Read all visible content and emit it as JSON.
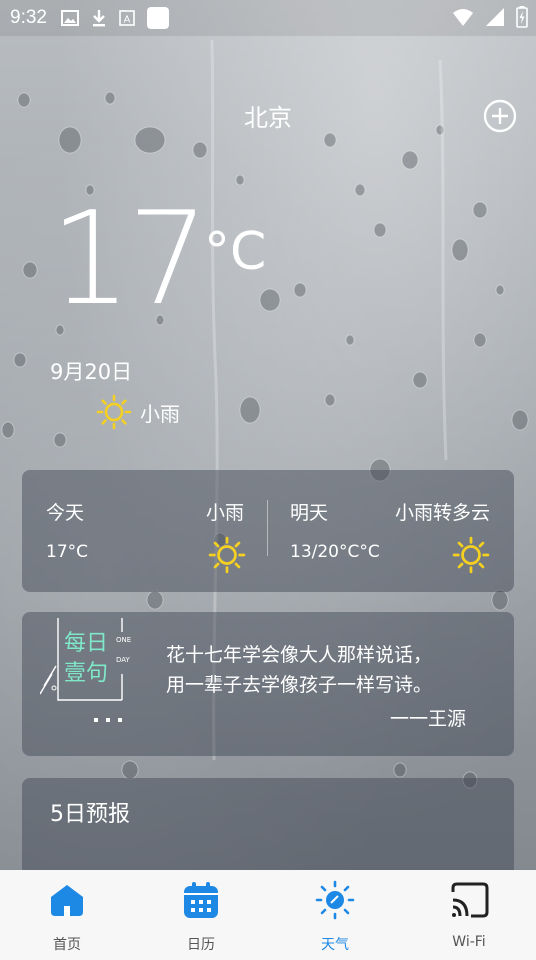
{
  "status_bar": {
    "time": "9:32",
    "icons": [
      "gallery-icon",
      "download-icon",
      "text-icon",
      "square-icon",
      "wifi-icon",
      "signal-icon",
      "battery-icon"
    ]
  },
  "header": {
    "city": "北京",
    "add_icon": "add-circle-icon"
  },
  "current": {
    "temperature": "17",
    "unit": "°C",
    "date": "9月20日",
    "condition": "小雨",
    "condition_icon": "sun-icon"
  },
  "today_card": {
    "today": {
      "label": "今天",
      "condition": "小雨",
      "temp": "17°C"
    },
    "tomorrow": {
      "label": "明天",
      "condition": "小雨转多云",
      "temp": "13/20°C°C"
    }
  },
  "quote_card": {
    "badge_cn_line1": "每日",
    "badge_cn_line2": "壹句",
    "badge_en_line1": "ONE",
    "badge_en_line2": "DAY",
    "text_line1": "花十七年学会像大人那样说话，",
    "text_line2": "用一辈子去学像孩子一样写诗。",
    "author": "一一王源"
  },
  "forecast": {
    "title": "5日预报"
  },
  "bottom_nav": {
    "items": [
      {
        "label": "首页",
        "icon": "home-icon",
        "active": false
      },
      {
        "label": "日历",
        "icon": "calendar-icon",
        "active": false
      },
      {
        "label": "天气",
        "icon": "weather-icon",
        "active": true
      },
      {
        "label": "Wi-Fi",
        "icon": "cast-icon",
        "active": false
      }
    ]
  },
  "colors": {
    "accent": "#1e88e5",
    "sun": "#f5d020",
    "badge": "#7fe8c8",
    "nav_bg": "#f7f7f7"
  }
}
